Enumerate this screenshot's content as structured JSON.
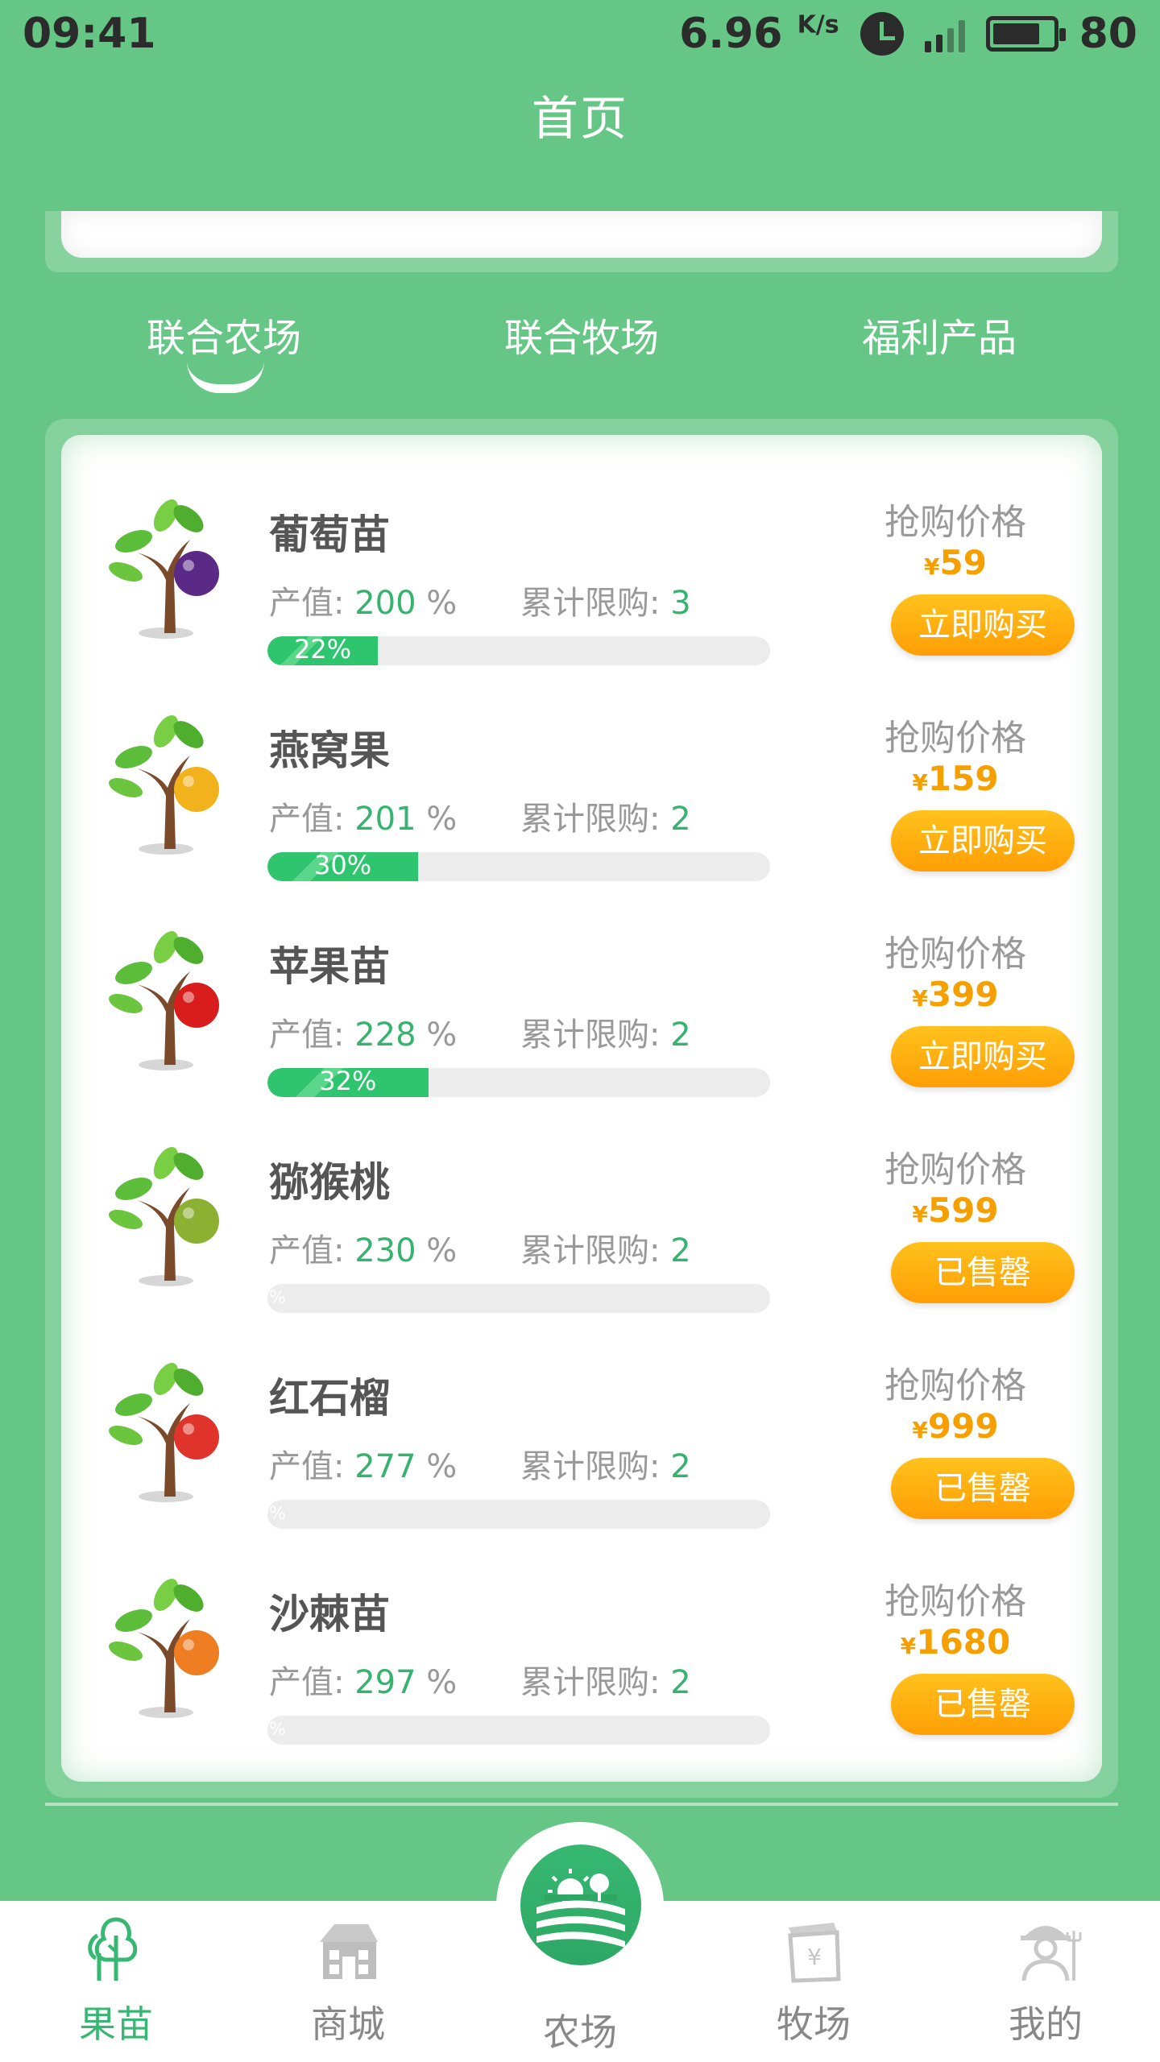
{
  "status_bar": {
    "time": "09:41",
    "net_speed": "6.96",
    "net_unit": "K/s",
    "network": "4G",
    "battery": "80"
  },
  "header": {
    "title": "首页"
  },
  "tabs": [
    {
      "label": "联合农场",
      "active": true
    },
    {
      "label": "联合牧场",
      "active": false
    },
    {
      "label": "福利产品",
      "active": false
    }
  ],
  "product_labels": {
    "output": "产值:",
    "limit": "累计限购:",
    "price_label": "抢购价格",
    "currency": "¥",
    "percent": "%"
  },
  "products": [
    {
      "name": "葡萄苗",
      "output": "200",
      "limit": "3",
      "price": "59",
      "progress": 22,
      "progress_text": "22%",
      "button": "立即购买",
      "icon": "grape-tree-icon",
      "fruit_color": "#5b2a86"
    },
    {
      "name": "燕窝果",
      "output": "201",
      "limit": "2",
      "price": "159",
      "progress": 30,
      "progress_text": "30%",
      "button": "立即购买",
      "icon": "bird-nest-fruit-tree-icon",
      "fruit_color": "#f2b21c"
    },
    {
      "name": "苹果苗",
      "output": "228",
      "limit": "2",
      "price": "399",
      "progress": 32,
      "progress_text": "32%",
      "button": "立即购买",
      "icon": "apple-tree-icon",
      "fruit_color": "#d91c1c"
    },
    {
      "name": "猕猴桃",
      "output": "230",
      "limit": "2",
      "price": "599",
      "progress": 0,
      "progress_text": "%",
      "button": "已售罄",
      "icon": "kiwi-tree-icon",
      "fruit_color": "#8bb032"
    },
    {
      "name": "红石榴",
      "output": "277",
      "limit": "2",
      "price": "999",
      "progress": 0,
      "progress_text": "%",
      "button": "已售罄",
      "icon": "pomegranate-tree-icon",
      "fruit_color": "#e0332b"
    },
    {
      "name": "沙棘苗",
      "output": "297",
      "limit": "2",
      "price": "1680",
      "progress": 0,
      "progress_text": "%",
      "button": "已售罄",
      "icon": "sea-buckthorn-tree-icon",
      "fruit_color": "#ef7d22"
    }
  ],
  "bottom_nav": [
    {
      "label": "果苗",
      "icon": "tree-icon",
      "active": true
    },
    {
      "label": "商城",
      "icon": "store-icon",
      "active": false
    },
    {
      "label": "农场",
      "icon": "farm-icon",
      "active": false
    },
    {
      "label": "牧场",
      "icon": "pasture-icon",
      "active": false
    },
    {
      "label": "我的",
      "icon": "farmer-profile-icon",
      "active": false
    }
  ],
  "colors": {
    "primary_green": "#66c685",
    "accent_orange": "#ff9e05",
    "value_green": "#35b46f"
  }
}
